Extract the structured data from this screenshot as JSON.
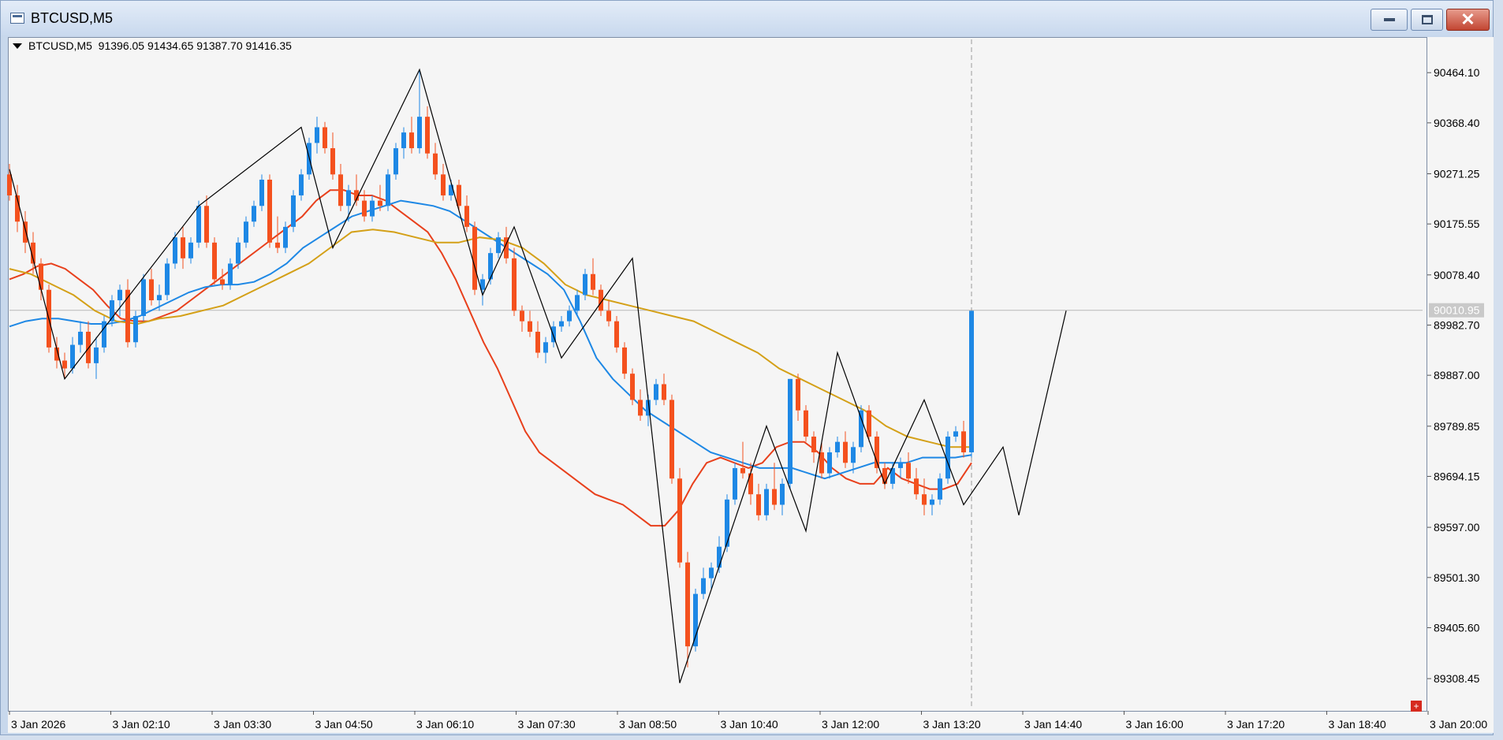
{
  "window": {
    "title": "BTCUSD,M5"
  },
  "chart": {
    "info": "BTCUSD,M5  91396.05 91434.65 91387.70 91416.35",
    "current_price": "90010.95",
    "colors": {
      "bull": "#1e88e5",
      "bear": "#f4511e",
      "ma_red": "#e8401c",
      "ma_blue": "#1e88e5",
      "ma_gold": "#d4a017",
      "zigzag": "#000000",
      "background": "#f5f5f5"
    }
  },
  "chart_data": {
    "type": "candlestick",
    "title": "BTCUSD,M5",
    "ylim": [
      89250,
      90520
    ],
    "y_ticks": [
      "90464.10",
      "90368.40",
      "90271.25",
      "90175.55",
      "90078.40",
      "89982.70",
      "89887.00",
      "89789.85",
      "89694.15",
      "89597.00",
      "89501.30",
      "89405.60",
      "89308.45"
    ],
    "x_ticks": [
      "3 Jan 2026",
      "3 Jan 02:10",
      "3 Jan 03:30",
      "3 Jan 04:50",
      "3 Jan 06:10",
      "3 Jan 07:30",
      "3 Jan 08:50",
      "3 Jan 10:40",
      "3 Jan 12:00",
      "3 Jan 13:20",
      "3 Jan 14:40",
      "3 Jan 16:00",
      "3 Jan 17:20",
      "3 Jan 18:40",
      "3 Jan 20:00"
    ],
    "candles": [
      [
        90270,
        90290,
        90220,
        90230
      ],
      [
        90230,
        90250,
        90160,
        90180
      ],
      [
        90180,
        90200,
        90120,
        90140
      ],
      [
        90140,
        90160,
        90080,
        90100
      ],
      [
        90100,
        90110,
        90030,
        90050
      ],
      [
        90050,
        90060,
        89930,
        89940
      ],
      [
        89940,
        89960,
        89900,
        89915
      ],
      [
        89915,
        89930,
        89880,
        89900
      ],
      [
        89900,
        89960,
        89890,
        89945
      ],
      [
        89945,
        89990,
        89930,
        89970
      ],
      [
        89970,
        89990,
        89900,
        89910
      ],
      [
        89910,
        89960,
        89880,
        89940
      ],
      [
        89940,
        90000,
        89930,
        89990
      ],
      [
        89990,
        90040,
        89980,
        90030
      ],
      [
        90030,
        90060,
        90000,
        90050
      ],
      [
        90050,
        90070,
        89940,
        89950
      ],
      [
        89950,
        90010,
        89940,
        90000
      ],
      [
        90000,
        90080,
        89990,
        90070
      ],
      [
        90070,
        90090,
        90020,
        90030
      ],
      [
        90030,
        90060,
        90010,
        90040
      ],
      [
        90040,
        90110,
        90030,
        90100
      ],
      [
        90100,
        90160,
        90090,
        90150
      ],
      [
        90150,
        90170,
        90090,
        90110
      ],
      [
        90110,
        90150,
        90100,
        90140
      ],
      [
        90140,
        90220,
        90130,
        90210
      ],
      [
        90210,
        90230,
        90130,
        90140
      ],
      [
        90140,
        90150,
        90060,
        90070
      ],
      [
        90070,
        90090,
        90050,
        90060
      ],
      [
        90060,
        90110,
        90050,
        90100
      ],
      [
        90100,
        90150,
        90090,
        90140
      ],
      [
        90140,
        90190,
        90130,
        90180
      ],
      [
        90180,
        90220,
        90170,
        90210
      ],
      [
        90210,
        90270,
        90200,
        90260
      ],
      [
        90260,
        90270,
        90130,
        90140
      ],
      [
        90140,
        90190,
        90120,
        90130
      ],
      [
        90130,
        90180,
        90120,
        90170
      ],
      [
        90170,
        90240,
        90160,
        90230
      ],
      [
        90230,
        90280,
        90220,
        90270
      ],
      [
        90270,
        90340,
        90260,
        90330
      ],
      [
        90330,
        90380,
        90310,
        90360
      ],
      [
        90360,
        90370,
        90310,
        90320
      ],
      [
        90320,
        90350,
        90260,
        90270
      ],
      [
        90270,
        90290,
        90200,
        90210
      ],
      [
        90210,
        90250,
        90180,
        90240
      ],
      [
        90240,
        90270,
        90210,
        90220
      ],
      [
        90220,
        90240,
        90180,
        90190
      ],
      [
        90190,
        90230,
        90180,
        90220
      ],
      [
        90220,
        90250,
        90200,
        90210
      ],
      [
        90210,
        90280,
        90200,
        90270
      ],
      [
        90270,
        90330,
        90260,
        90320
      ],
      [
        90320,
        90360,
        90300,
        90350
      ],
      [
        90350,
        90380,
        90310,
        90320
      ],
      [
        90320,
        90470,
        90310,
        90380
      ],
      [
        90380,
        90400,
        90300,
        90310
      ],
      [
        90310,
        90330,
        90260,
        90270
      ],
      [
        90270,
        90290,
        90220,
        90230
      ],
      [
        90230,
        90260,
        90220,
        90250
      ],
      [
        90250,
        90260,
        90200,
        90210
      ],
      [
        90210,
        90230,
        90160,
        90170
      ],
      [
        90170,
        90180,
        90040,
        90050
      ],
      [
        90050,
        90080,
        90020,
        90070
      ],
      [
        90070,
        90130,
        90060,
        90120
      ],
      [
        90120,
        90160,
        90110,
        90150
      ],
      [
        90150,
        90170,
        90100,
        90110
      ],
      [
        90110,
        90130,
        90000,
        90010
      ],
      [
        90010,
        90020,
        89970,
        89990
      ],
      [
        89990,
        90010,
        89960,
        89970
      ],
      [
        89970,
        89990,
        89920,
        89930
      ],
      [
        89930,
        89960,
        89910,
        89950
      ],
      [
        89950,
        89990,
        89940,
        89980
      ],
      [
        89980,
        90000,
        89970,
        89990
      ],
      [
        89990,
        90020,
        89980,
        90010
      ],
      [
        90010,
        90050,
        90000,
        90040
      ],
      [
        90040,
        90090,
        90030,
        90080
      ],
      [
        90080,
        90110,
        90040,
        90050
      ],
      [
        90050,
        90060,
        90000,
        90010
      ],
      [
        90010,
        90030,
        89980,
        89990
      ],
      [
        89990,
        90000,
        89930,
        89940
      ],
      [
        89940,
        89950,
        89880,
        89890
      ],
      [
        89890,
        89900,
        89830,
        89840
      ],
      [
        89840,
        89860,
        89800,
        89810
      ],
      [
        89810,
        89850,
        89790,
        89840
      ],
      [
        89840,
        89880,
        89830,
        89870
      ],
      [
        89870,
        89890,
        89830,
        89840
      ],
      [
        89840,
        89850,
        89680,
        89690
      ],
      [
        89690,
        89710,
        89520,
        89530
      ],
      [
        89530,
        89550,
        89330,
        89370
      ],
      [
        89370,
        89480,
        89360,
        89470
      ],
      [
        89470,
        89520,
        89460,
        89500
      ],
      [
        89500,
        89530,
        89480,
        89520
      ],
      [
        89520,
        89580,
        89510,
        89560
      ],
      [
        89560,
        89660,
        89550,
        89650
      ],
      [
        89650,
        89720,
        89640,
        89710
      ],
      [
        89710,
        89760,
        89690,
        89700
      ],
      [
        89700,
        89720,
        89640,
        89660
      ],
      [
        89660,
        89680,
        89610,
        89620
      ],
      [
        89620,
        89680,
        89610,
        89670
      ],
      [
        89670,
        89720,
        89630,
        89640
      ],
      [
        89640,
        89690,
        89620,
        89680
      ],
      [
        89680,
        89880,
        89670,
        89880
      ],
      [
        89880,
        89890,
        89800,
        89820
      ],
      [
        89820,
        89830,
        89760,
        89770
      ],
      [
        89770,
        89780,
        89720,
        89740
      ],
      [
        89740,
        89760,
        89690,
        89700
      ],
      [
        89700,
        89750,
        89690,
        89740
      ],
      [
        89740,
        89770,
        89730,
        89760
      ],
      [
        89760,
        89780,
        89710,
        89720
      ],
      [
        89720,
        89760,
        89700,
        89750
      ],
      [
        89750,
        89830,
        89740,
        89820
      ],
      [
        89820,
        89830,
        89760,
        89770
      ],
      [
        89770,
        89780,
        89700,
        89710
      ],
      [
        89710,
        89720,
        89670,
        89680
      ],
      [
        89680,
        89720,
        89670,
        89710
      ],
      [
        89710,
        89730,
        89690,
        89720
      ],
      [
        89720,
        89740,
        89680,
        89690
      ],
      [
        89690,
        89710,
        89650,
        89660
      ],
      [
        89660,
        89690,
        89620,
        89640
      ],
      [
        89640,
        89660,
        89620,
        89650
      ],
      [
        89650,
        89700,
        89640,
        89690
      ],
      [
        89690,
        89780,
        89680,
        89770
      ],
      [
        89770,
        89790,
        89760,
        89780
      ],
      [
        89780,
        89800,
        89730,
        89740
      ],
      [
        89740,
        90010,
        89730,
        90010
      ]
    ],
    "moving_averages": [
      {
        "color": "ma_red",
        "values": [
          90070,
          90080,
          90095,
          90100,
          90090,
          90070,
          90050,
          90020,
          89995,
          89990,
          89990,
          90000,
          90010,
          90030,
          90050,
          90070,
          90090,
          90110,
          90130,
          90150,
          90170,
          90190,
          90220,
          90240,
          90240,
          90230,
          90230,
          90220,
          90200,
          90180,
          90160,
          90120,
          90070,
          90010,
          89950,
          89900,
          89840,
          89780,
          89740,
          89720,
          89700,
          89680,
          89660,
          89650,
          89640,
          89620,
          89600,
          89600,
          89630,
          89680,
          89720,
          89730,
          89720,
          89710,
          89720,
          89750,
          89760,
          89760,
          89740,
          89710,
          89690,
          89680,
          89680,
          89710,
          89690,
          89680,
          89670,
          89670,
          89680,
          89720
        ]
      },
      {
        "color": "ma_blue",
        "values": [
          89980,
          89990,
          89995,
          89995,
          89990,
          89985,
          89985,
          89990,
          90000,
          90015,
          90030,
          90045,
          90055,
          90060,
          90060,
          90065,
          90080,
          90100,
          90130,
          90150,
          90170,
          90190,
          90200,
          90210,
          90220,
          90215,
          90210,
          90200,
          90180,
          90160,
          90140,
          90120,
          90100,
          90080,
          90050,
          89990,
          89920,
          89880,
          89850,
          89820,
          89800,
          89780,
          89760,
          89740,
          89730,
          89720,
          89710,
          89710,
          89710,
          89700,
          89690,
          89700,
          89710,
          89720,
          89720,
          89720,
          89730,
          89730,
          89730,
          89735
        ]
      },
      {
        "color": "ma_gold",
        "values": [
          90090,
          90080,
          90060,
          90040,
          90010,
          89990,
          89985,
          89995,
          90000,
          90010,
          90020,
          90040,
          90060,
          90080,
          90100,
          90130,
          90160,
          90165,
          90160,
          90150,
          90140,
          90140,
          90150,
          90145,
          90130,
          90100,
          90060,
          90040,
          90030,
          90020,
          90010,
          90000,
          89990,
          89970,
          89950,
          89930,
          89900,
          89880,
          89860,
          89840,
          89820,
          89790,
          89770,
          89760,
          89750,
          89750
        ]
      }
    ],
    "zigzag": [
      [
        0,
        90280
      ],
      [
        7,
        89880
      ],
      [
        24,
        90210
      ],
      [
        37,
        90360
      ],
      [
        41,
        90130
      ],
      [
        52,
        90470
      ],
      [
        60,
        90040
      ],
      [
        64,
        90170
      ],
      [
        70,
        89920
      ],
      [
        79,
        90110
      ],
      [
        85,
        89300
      ],
      [
        96,
        89790
      ],
      [
        101,
        89590
      ],
      [
        105,
        89930
      ],
      [
        111,
        89680
      ],
      [
        116,
        89840
      ],
      [
        121,
        89640
      ],
      [
        126,
        89750
      ],
      [
        128,
        89620
      ],
      [
        134,
        90010
      ]
    ]
  }
}
